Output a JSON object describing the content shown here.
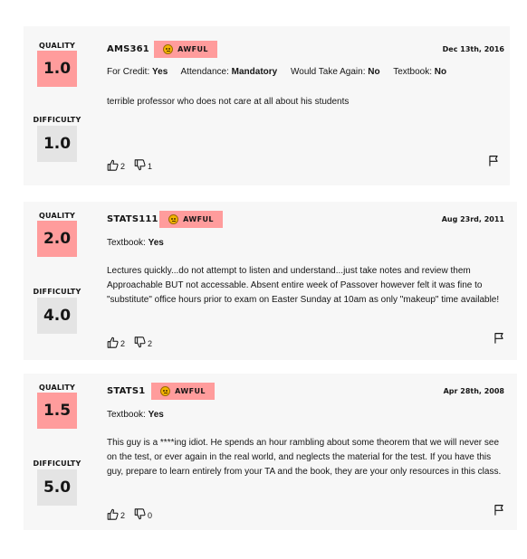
{
  "labels": {
    "quality": "QUALITY",
    "difficulty": "DIFFICULTY"
  },
  "colors": {
    "awful": "#ff9c9c",
    "difficulty_bg": "#e4e4e4",
    "card_bg": "#f7f7f7"
  },
  "reviews": [
    {
      "quality": "1.0",
      "difficulty": "1.0",
      "course": "AMS361",
      "tag": "AWFUL",
      "date": "Dec 13th, 2016",
      "meta": [
        {
          "label": "For Credit:",
          "value": "Yes"
        },
        {
          "label": "Attendance:",
          "value": "Mandatory"
        },
        {
          "label": "Would Take Again:",
          "value": "No"
        },
        {
          "label": "Textbook:",
          "value": "No"
        }
      ],
      "comment": "terrible professor who does not care at all about his students",
      "thumbs_up": "2",
      "thumbs_down": "1"
    },
    {
      "quality": "2.0",
      "difficulty": "4.0",
      "course": "STATS111",
      "tag": "AWFUL",
      "date": "Aug 23rd, 2011",
      "meta": [
        {
          "label": "Textbook:",
          "value": "Yes"
        }
      ],
      "comment": "Lectures quickly...do not attempt to listen and understand...just take notes and review them Approachable BUT not accessable. Absent entire week of Passover however felt it was fine to \"substitute\" office hours prior to exam on Easter Sunday at 10am as only \"makeup\" time available!",
      "thumbs_up": "2",
      "thumbs_down": "2"
    },
    {
      "quality": "1.5",
      "difficulty": "5.0",
      "course": "STATS1",
      "tag": "AWFUL",
      "date": "Apr 28th, 2008",
      "meta": [
        {
          "label": "Textbook:",
          "value": "Yes"
        }
      ],
      "comment": "This guy is a ****ing idiot. He spends an hour rambling about some theorem that we will never see on the test, or ever again in the real world, and neglects the material for the test. If you have this guy, prepare to learn entirely from your TA and the book, they are your only resources in this class.",
      "thumbs_up": "2",
      "thumbs_down": "0"
    }
  ]
}
